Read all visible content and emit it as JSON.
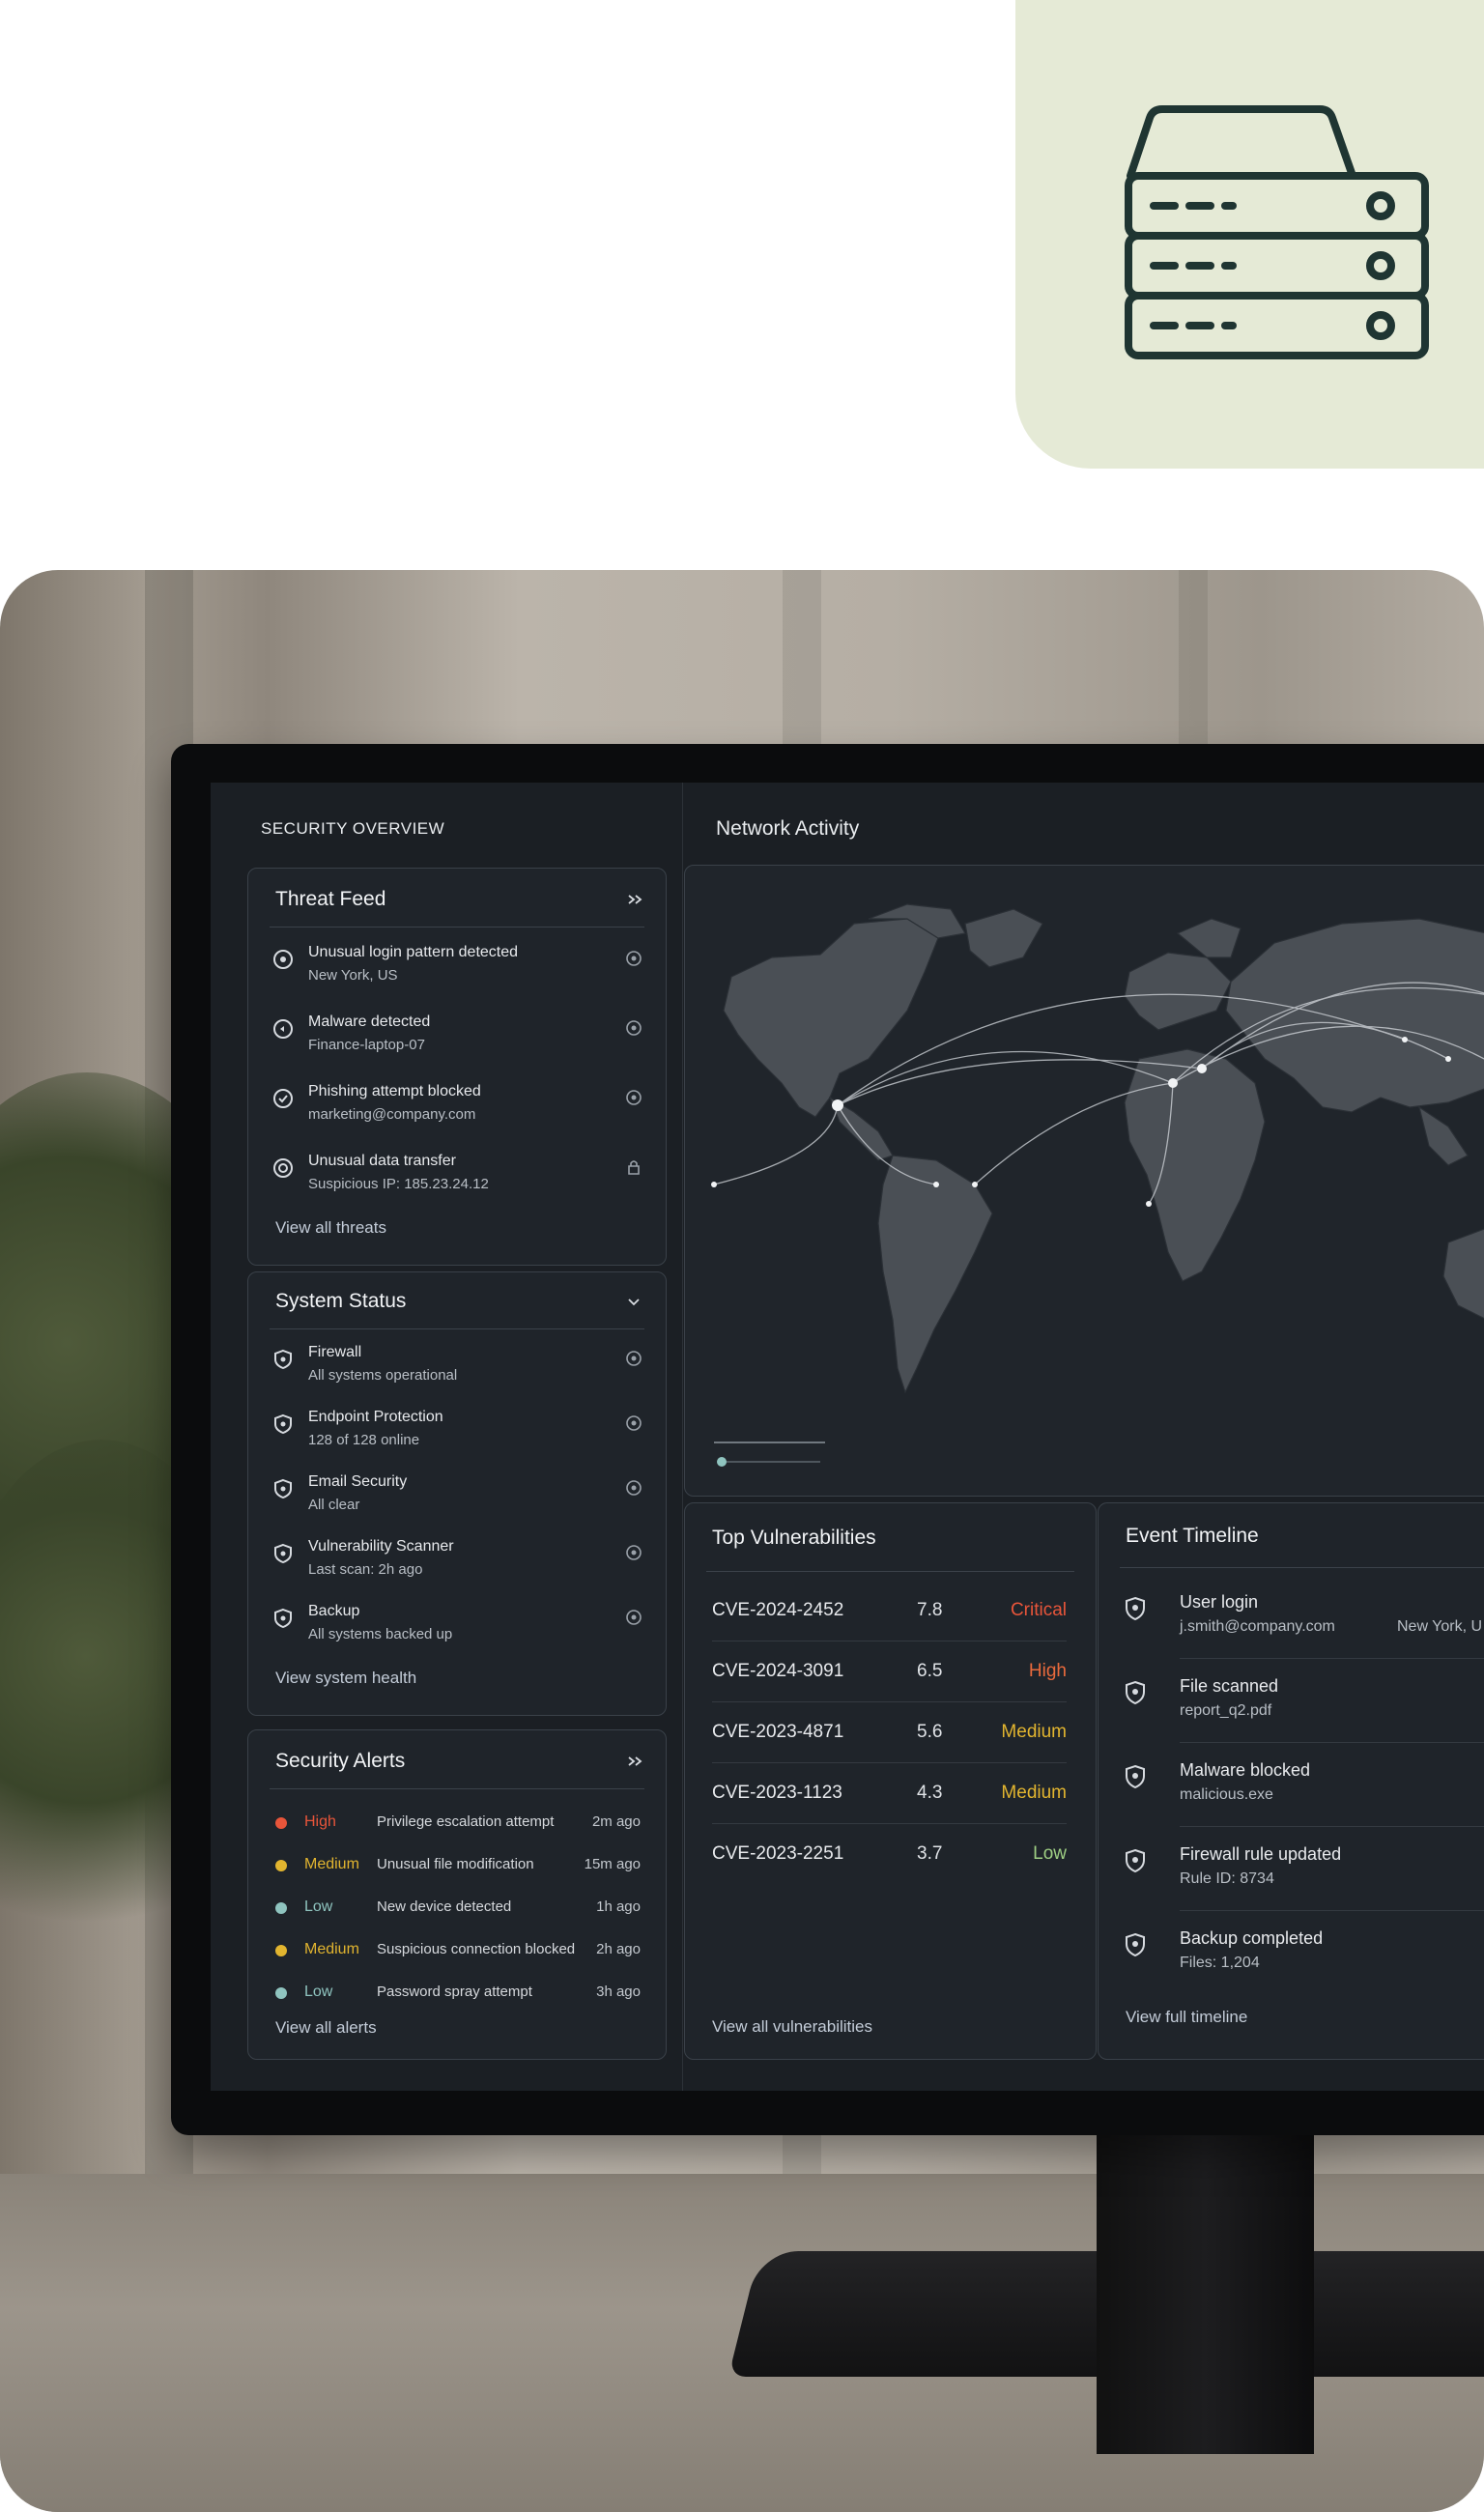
{
  "app_icon": {
    "name": "server-icon",
    "background": "#e5ead6",
    "stroke": "#1f3532"
  },
  "dashboard": {
    "section_title": "SECURITY OVERVIEW",
    "network_title": "Network Activity",
    "threat_feed": {
      "title": "Threat Feed",
      "items": [
        {
          "title": "Unusual login pattern detected",
          "detail": "New York, US"
        },
        {
          "title": "Malware detected",
          "detail": "Finance-laptop-07"
        },
        {
          "title": "Phishing attempt blocked",
          "detail": "marketing@company.com"
        },
        {
          "title": "Unusual data transfer",
          "detail": "Suspicious IP: 185.23.24.12"
        }
      ],
      "link": "View all threats"
    },
    "system_status": {
      "title": "System Status",
      "items": [
        {
          "title": "Firewall",
          "detail": "All systems operational"
        },
        {
          "title": "Endpoint Protection",
          "detail": "128 of 128 online"
        },
        {
          "title": "Email Security",
          "detail": "All clear"
        },
        {
          "title": "Vulnerability Scanner",
          "detail": "Last scan: 2h ago"
        },
        {
          "title": "Backup",
          "detail": "All systems backed up"
        }
      ],
      "link": "View system health"
    },
    "security_alerts": {
      "title": "Security Alerts",
      "items": [
        {
          "severity": "High",
          "description": "Privilege escalation attempt",
          "time": "2m ago",
          "color": "#e8553a"
        },
        {
          "severity": "Medium",
          "description": "Unusual file modification",
          "time": "15m ago",
          "color": "#e2b52f"
        },
        {
          "severity": "Low",
          "description": "New device detected",
          "time": "1h ago",
          "color": "#8fc4bf"
        },
        {
          "severity": "Medium",
          "description": "Suspicious connection blocked",
          "time": "2h ago",
          "color": "#e2b52f"
        },
        {
          "severity": "Low",
          "description": "Password spray attempt",
          "time": "3h ago",
          "color": "#8fc4bf"
        }
      ],
      "link": "View all alerts"
    },
    "vulnerabilities": {
      "title": "Top Vulnerabilities",
      "items": [
        {
          "id": "CVE-2024-2452",
          "score": "7.8",
          "severity": "Critical",
          "color": "#e8553a"
        },
        {
          "id": "CVE-2024-3091",
          "score": "6.5",
          "severity": "High",
          "color": "#ea6a3c"
        },
        {
          "id": "CVE-2023-4871",
          "score": "5.6",
          "severity": "Medium",
          "color": "#e2b52f"
        },
        {
          "id": "CVE-2023-1123",
          "score": "4.3",
          "severity": "Medium",
          "color": "#e2b52f"
        },
        {
          "id": "CVE-2023-2251",
          "score": "3.7",
          "severity": "Low",
          "color": "#9fcf84"
        }
      ],
      "link": "View all vulnerabilities"
    },
    "event_timeline": {
      "title": "Event Timeline",
      "items": [
        {
          "title": "User login",
          "detail": "j.smith@company.com",
          "extra": "New York, U"
        },
        {
          "title": "File scanned",
          "detail": "report_q2.pdf"
        },
        {
          "title": "Malware blocked",
          "detail": "malicious.exe"
        },
        {
          "title": "Firewall rule updated",
          "detail": "Rule ID: 8734"
        },
        {
          "title": "Backup completed",
          "detail": "Files: 1,204"
        }
      ],
      "link": "View full timeline"
    }
  }
}
